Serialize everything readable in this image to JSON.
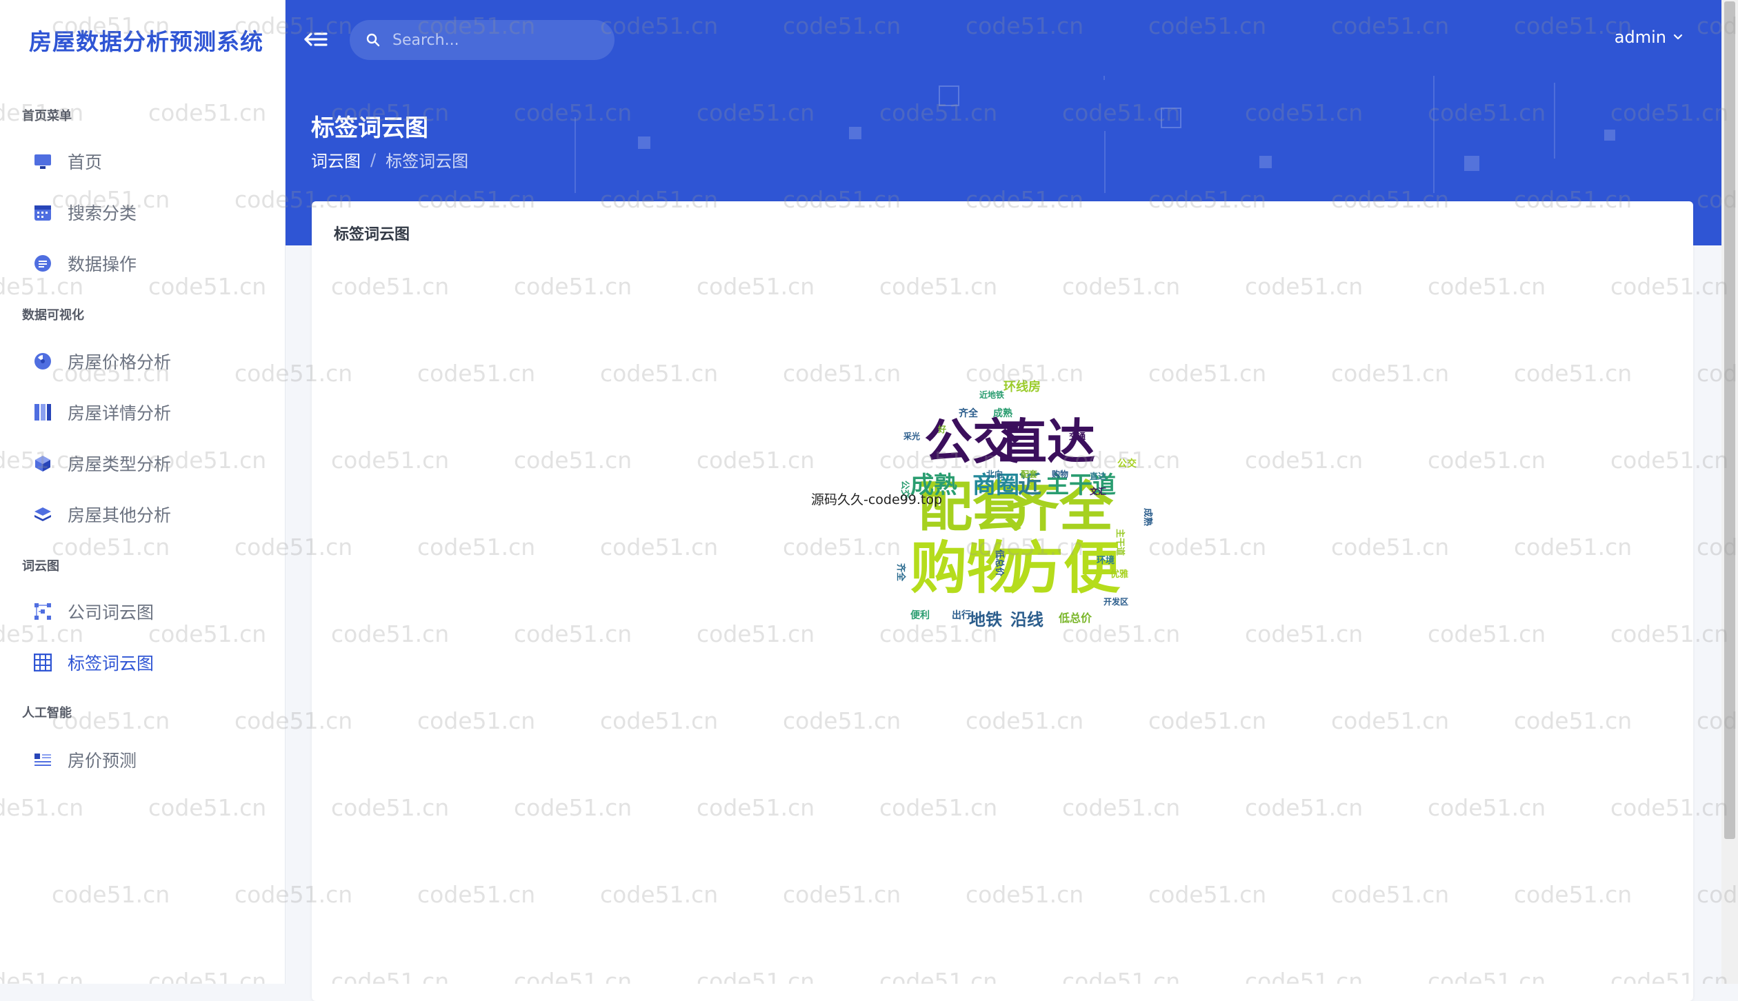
{
  "app": {
    "brand": "房屋数据分析预测系统"
  },
  "sidebar": {
    "sections": [
      {
        "title": "首页菜单",
        "items": [
          {
            "label": "首页",
            "icon": "monitor-icon"
          },
          {
            "label": "搜索分类",
            "icon": "calendar-icon"
          },
          {
            "label": "数据操作",
            "icon": "message-icon"
          }
        ]
      },
      {
        "title": "数据可视化",
        "items": [
          {
            "label": "房屋价格分析",
            "icon": "pie-icon"
          },
          {
            "label": "房屋详情分析",
            "icon": "columns-icon"
          },
          {
            "label": "房屋类型分析",
            "icon": "cube-icon"
          },
          {
            "label": "房屋其他分析",
            "icon": "layers-icon"
          }
        ]
      },
      {
        "title": "词云图",
        "items": [
          {
            "label": "公司词云图",
            "icon": "network-icon"
          },
          {
            "label": "标签词云图",
            "icon": "grid-icon",
            "active": true
          }
        ]
      },
      {
        "title": "人工智能",
        "items": [
          {
            "label": "房价预测",
            "icon": "list-icon"
          }
        ]
      }
    ]
  },
  "header": {
    "search_placeholder": "Search...",
    "user": "admin",
    "page_title": "标签词云图",
    "breadcrumb": [
      "词云图",
      "标签词云图"
    ]
  },
  "card": {
    "title": "标签词云图",
    "overlay_text": "源码久久-code99.top",
    "cloud_words": [
      "公交",
      "直达",
      "配套",
      "齐全",
      "购物",
      "方便",
      "成熟",
      "商圈",
      "近",
      "主干道",
      "地铁",
      "沿线",
      "低总价",
      "环线房",
      "齐全",
      "成熟",
      "开发区",
      "直达",
      "公交",
      "文汇",
      "北向",
      "配套",
      "购物",
      "出行",
      "便利",
      "环境",
      "优雅",
      "采光",
      "好",
      "交通",
      "近地铁"
    ]
  },
  "watermark": "code51.cn",
  "colors": {
    "primary": "#2f55d4",
    "sidebar_bg": "#ffffff",
    "page_bg": "#f4f6fa"
  }
}
